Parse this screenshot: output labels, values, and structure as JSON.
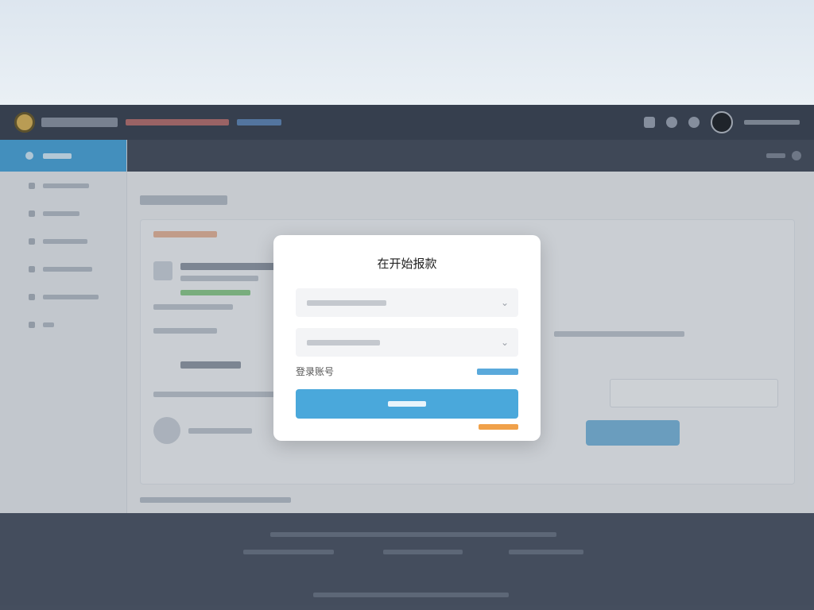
{
  "colors": {
    "accent": "#4aa8db",
    "header_dark": "#3a4352",
    "page_header": "#454e5d",
    "footer": "#4b5465",
    "link_orange": "#f0a14a",
    "link_blue": "#5aa9db"
  },
  "modal": {
    "title": "在开始报款",
    "login_label": "登录账号"
  },
  "icons": [
    "chevron-down-icon",
    "chevron-down-icon"
  ]
}
